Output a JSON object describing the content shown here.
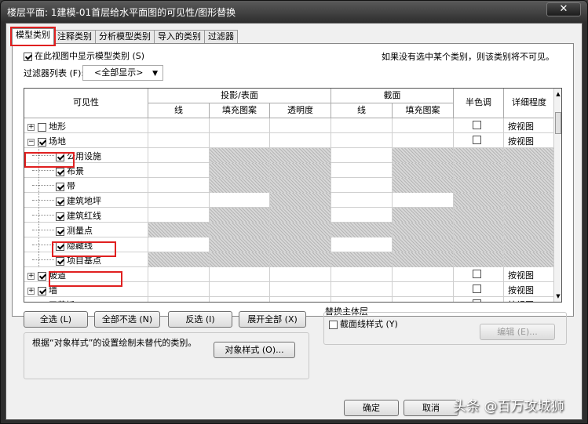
{
  "window": {
    "title": "楼层平面: 1建模-01首层给水平面图的可见性/图形替换",
    "close_glyph": "✕"
  },
  "tabs": [
    {
      "label": "模型类别",
      "active": true
    },
    {
      "label": "注释类别",
      "active": false
    },
    {
      "label": "分析模型类别",
      "active": false
    },
    {
      "label": "导入的类别",
      "active": false
    },
    {
      "label": "过滤器",
      "active": false
    }
  ],
  "show_model_categories": {
    "label": "在此视图中显示模型类别 (S)",
    "checked": true
  },
  "hint_text": "如果没有选中某个类别，则该类别将不可见。",
  "filter_list": {
    "label": "过滤器列表 (F):",
    "value": "<全部显示>"
  },
  "table": {
    "headers": {
      "visibility": "可见性",
      "projection_surface": "投影/表面",
      "line": "线",
      "fill_pattern": "填充图案",
      "transparency": "透明度",
      "cut": "截面",
      "cut_line": "线",
      "cut_fill": "填充图案",
      "halftone": "半色调",
      "detail_level": "详细程度"
    },
    "rows": [
      {
        "name": "地形",
        "level": 0,
        "expander": "+",
        "checked": false,
        "halftone": true,
        "detail": "按视图"
      },
      {
        "name": "场地",
        "level": 0,
        "expander": "−",
        "checked": true,
        "halftone": true,
        "detail": "按视图"
      },
      {
        "name": "公用设施",
        "level": 1,
        "checked": true
      },
      {
        "name": "布景",
        "level": 1,
        "checked": true
      },
      {
        "name": "带",
        "level": 1,
        "checked": true
      },
      {
        "name": "建筑地坪",
        "level": 1,
        "checked": true
      },
      {
        "name": "建筑红线",
        "level": 1,
        "checked": true
      },
      {
        "name": "测量点",
        "level": 1,
        "checked": true
      },
      {
        "name": "隐藏线",
        "level": 1,
        "checked": true
      },
      {
        "name": "项目基点",
        "level": 1,
        "checked": true
      },
      {
        "name": "坡道",
        "level": 0,
        "expander": "+",
        "checked": true,
        "halftone": true,
        "detail": "按视图"
      },
      {
        "name": "墙",
        "level": 0,
        "expander": "+",
        "checked": true,
        "halftone": true,
        "detail": "按视图"
      },
      {
        "name": "天花板",
        "level": 0,
        "expander": "+",
        "checked": true,
        "halftone": true,
        "detail": "按视图"
      }
    ]
  },
  "buttons": {
    "select_all": "全选 (L)",
    "select_none": "全部不选 (N)",
    "invert": "反选 (I)",
    "expand_all": "展开全部 (X)",
    "object_styles": "对象样式 (O)...",
    "edit": "编辑 (E)...",
    "ok": "确定",
    "cancel": "取消"
  },
  "object_style_note": "根据“对象样式”的设置绘制未替代的类别。",
  "host_layers": {
    "title": "替换主体层",
    "cut_line_styles": {
      "label": "截面线样式 (Y)",
      "checked": false
    }
  },
  "watermark": "头条 @百万攻城狮"
}
